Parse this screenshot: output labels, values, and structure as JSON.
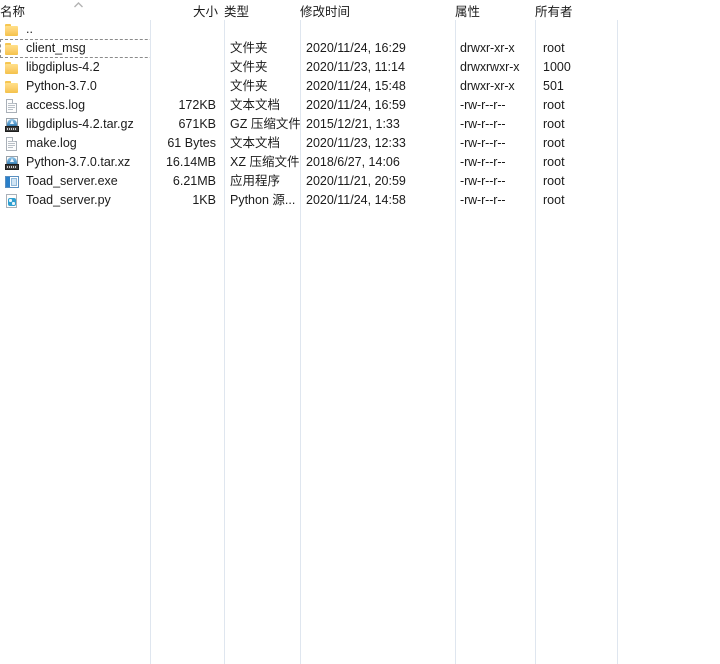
{
  "columns": {
    "name": "名称",
    "size": "大小",
    "type": "类型",
    "modified": "修改时间",
    "attributes": "属性",
    "owner": "所有者",
    "sort_indicator": "ascending-caret"
  },
  "parent_row": {
    "name": "..",
    "icon": "folder-icon"
  },
  "rows": [
    {
      "name": "client_msg",
      "icon": "folder-icon",
      "size": "",
      "type": "文件夹",
      "modified": "2020/11/24, 16:29",
      "attributes": "drwxr-xr-x",
      "owner": "root",
      "selected": true
    },
    {
      "name": "libgdiplus-4.2",
      "icon": "folder-icon",
      "size": "",
      "type": "文件夹",
      "modified": "2020/11/23, 11:14",
      "attributes": "drwxrwxr-x",
      "owner": "1000",
      "selected": false
    },
    {
      "name": "Python-3.7.0",
      "icon": "folder-icon",
      "size": "",
      "type": "文件夹",
      "modified": "2020/11/24, 15:48",
      "attributes": "drwxr-xr-x",
      "owner": "501",
      "selected": false
    },
    {
      "name": "access.log",
      "icon": "text-document-icon",
      "size": "172KB",
      "type": "文本文档",
      "modified": "2020/11/24, 16:59",
      "attributes": "-rw-r--r--",
      "owner": "root",
      "selected": false
    },
    {
      "name": "libgdiplus-4.2.tar.gz",
      "icon": "archive-icon",
      "size": "671KB",
      "type": "GZ 压缩文件",
      "modified": "2015/12/21, 1:33",
      "attributes": "-rw-r--r--",
      "owner": "root",
      "selected": false
    },
    {
      "name": "make.log",
      "icon": "text-document-icon",
      "size": "61 Bytes",
      "type": "文本文档",
      "modified": "2020/11/23, 12:33",
      "attributes": "-rw-r--r--",
      "owner": "root",
      "selected": false
    },
    {
      "name": "Python-3.7.0.tar.xz",
      "icon": "archive-icon",
      "size": "16.14MB",
      "type": "XZ 压缩文件",
      "modified": "2018/6/27, 14:06",
      "attributes": "-rw-r--r--",
      "owner": "root",
      "selected": false
    },
    {
      "name": "Toad_server.exe",
      "icon": "application-icon",
      "size": "6.21MB",
      "type": "应用程序",
      "modified": "2020/11/21, 20:59",
      "attributes": "-rw-r--r--",
      "owner": "root",
      "selected": false
    },
    {
      "name": "Toad_server.py",
      "icon": "python-file-icon",
      "size": "1KB",
      "type": "Python 源...",
      "modified": "2020/11/24, 14:58",
      "attributes": "-rw-r--r--",
      "owner": "root",
      "selected": false
    }
  ],
  "colors": {
    "folder": "#fdd272",
    "grid_line": "#dfe6ef",
    "text": "#1b1b1b",
    "selection_border": "#8a8a8a"
  }
}
